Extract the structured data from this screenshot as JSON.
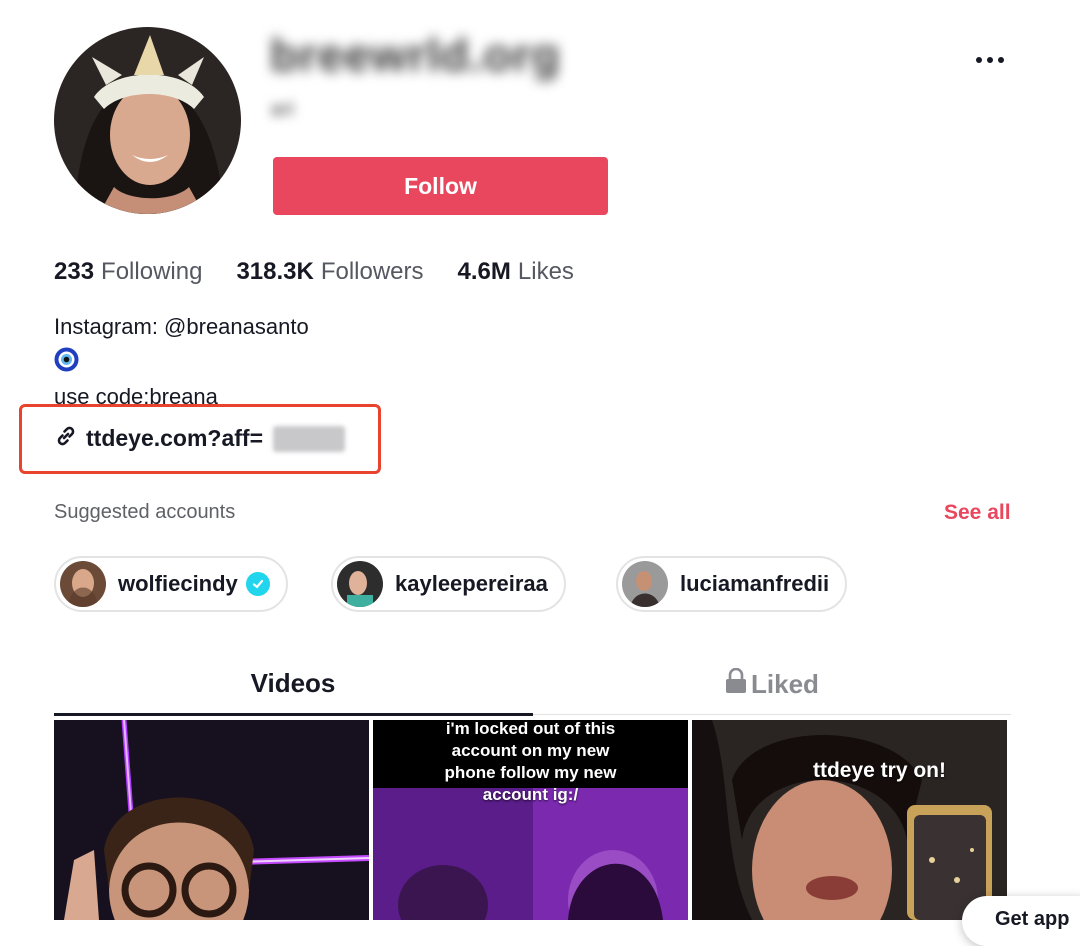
{
  "profile": {
    "username": "breewrld.org",
    "nickname": "ari",
    "follow_label": "Follow",
    "more_icon": "more-horizontal-icon"
  },
  "stats": [
    {
      "value": "233",
      "label": "Following"
    },
    {
      "value": "318.3K",
      "label": "Followers"
    },
    {
      "value": "4.6M",
      "label": "Likes"
    }
  ],
  "bio": {
    "line1": "Instagram: @breanasanto",
    "emoji_icon": "nazar-evil-eye-icon",
    "line3": "use code:breana",
    "link_text": "ttdeye.com?aff=",
    "link_icon": "link-icon"
  },
  "colors": {
    "accent": "#e9475e",
    "highlight_box": "#e8442d",
    "verified": "#20d5ec"
  },
  "suggested": {
    "title": "Suggested accounts",
    "see_all": "See all",
    "accounts": [
      {
        "name": "wolfiecindy",
        "verified": true
      },
      {
        "name": "kayleepereiraa",
        "verified": false
      },
      {
        "name": "luciamanfredii",
        "verified": false
      }
    ]
  },
  "tabs": {
    "videos": "Videos",
    "liked": "Liked",
    "liked_icon": "lock-icon"
  },
  "videos": [
    {
      "caption": ""
    },
    {
      "caption": "i'm locked out of this account on my new phone follow my new account ig:/"
    },
    {
      "caption": "ttdeye try on!"
    }
  ],
  "get_app": "Get app"
}
